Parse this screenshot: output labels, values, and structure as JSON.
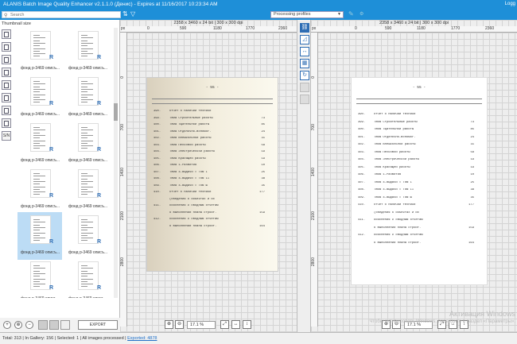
{
  "window": {
    "title": "ALANIS Batch Image Quality Enhancer v2.1.1.0 (Денис) - Expires at 11/16/2017 10:23:34 AM",
    "right_label": "Logg"
  },
  "toolbar": {
    "search_placeholder": "Search",
    "processing_profiles": "Processing profiles"
  },
  "left_panel": {
    "thumbnail_size_label": "Thumbnail size",
    "side_tools": [
      {
        "icon": "page-icon"
      },
      {
        "icon": "page-icon"
      },
      {
        "icon": "page-icon"
      },
      {
        "icon": "page-icon"
      },
      {
        "icon": "folder-icon"
      },
      {
        "icon": "page-icon"
      },
      {
        "icon": "page-icon"
      },
      {
        "icon": "page-icon"
      },
      {
        "icon": "sn",
        "label": "S/N"
      }
    ],
    "thumbnails": [
      {
        "caption": "фонд р-3469 описъ...",
        "badge": "R",
        "selected": false
      },
      {
        "caption": "фонд р-3469 описъ...",
        "badge": "R",
        "selected": false
      },
      {
        "caption": "фонд р-3469 описъ...",
        "badge": "R",
        "selected": false
      },
      {
        "caption": "фонд р-3469 описъ...",
        "badge": "R",
        "selected": false
      },
      {
        "caption": "фонд р-3469 описъ...",
        "badge": "R",
        "selected": false
      },
      {
        "caption": "фонд р-3469 описъ...",
        "badge": "R",
        "selected": false
      },
      {
        "caption": "фонд р-3469 описъ...",
        "badge": "R",
        "selected": false
      },
      {
        "caption": "фонд р-3469 описъ...",
        "badge": "R",
        "selected": false
      },
      {
        "caption": "фонд р-3469 описъ...",
        "badge": "R",
        "selected": true
      },
      {
        "caption": "фонд р-3469 описъ...",
        "badge": "R",
        "selected": false
      },
      {
        "caption": "фонд р-3469 описъ...",
        "badge": "R",
        "selected": false
      },
      {
        "caption": "фонд р-3469 описъ...",
        "badge": "R",
        "selected": false
      }
    ],
    "export_label": "EXPORT"
  },
  "left_viewer": {
    "info": "2358 x 3460 x 24 bit | 300 x 300 dpi",
    "unit": "px",
    "ruler_h": [
      "0",
      "590",
      "1180",
      "1770",
      "2360"
    ],
    "ruler_v": [
      "0",
      "700",
      "1400",
      "2100",
      "2800"
    ],
    "zoom": "17.1 %"
  },
  "right_viewer": {
    "info": "2358 x 3460 x 24 bit | 300 x 300 dpi",
    "unit": "px",
    "ruler_h": [
      "0",
      "590",
      "1180",
      "1770",
      "2360"
    ],
    "ruler_v": [
      "0",
      "700",
      "1400",
      "2100",
      "2800"
    ],
    "zoom": "17.1 %"
  },
  "document": {
    "page_header": "- 55 -",
    "rows": [
      {
        "n": "390.",
        "text": "Отчет о наличии техники",
        "v": ""
      },
      {
        "n": "399.",
        "text": "Тема Строительные работы",
        "v": "73"
      },
      {
        "n": "400.",
        "text": "Тема Тщательной работы",
        "v": "85"
      },
      {
        "n": "401.",
        "text": "Тема Отделочно-вспомог.",
        "v": "24"
      },
      {
        "n": "402.",
        "text": "Тема Внешкольной работы",
        "v": "31"
      },
      {
        "n": "403.",
        "text": "Тема Песковой работы",
        "v": "58"
      },
      {
        "n": "404.",
        "text": "Тема Электрической работы",
        "v": "19"
      },
      {
        "n": "405.",
        "text": "Тема Красящей работы",
        "v": "19"
      },
      {
        "n": "406.",
        "text": "Тема 1-Развития",
        "v": "10"
      },
      {
        "n": "407.",
        "text": "Тема 4-Выдачи = Том I",
        "v": "25"
      },
      {
        "n": "408.",
        "text": "Тема 4-Выдачи = Том II",
        "v": "38"
      },
      {
        "n": "409.",
        "text": "Тема 4-Выдачи = Том Ш",
        "v": "35"
      },
      {
        "n": "410.",
        "text": "Отчет о наличии техники",
        "v": "177"
      },
      {
        "n": "",
        "text": "(сведения о объектах и их",
        "v": ""
      },
      {
        "n": "411.",
        "text": "Пояснения к сводным отчетам",
        "v": ""
      },
      {
        "n": "",
        "text": "о выполнении плана строит.",
        "v": "159"
      },
      {
        "n": "412.",
        "text": "Пояснения к сводным отчетам",
        "v": ""
      },
      {
        "n": "",
        "text": "о выполнении плана строит.",
        "v": "164"
      }
    ]
  },
  "status_bar": {
    "total": "Total: 313",
    "in_gallery": "In Gallery: 156",
    "selected": "Selected: 1",
    "all_processed": "All images processed",
    "exported": "Exported: 4878"
  },
  "watermark": {
    "line1": "Активация Windows",
    "line2": "Чтобы активировать Windows, перейдите в раздел «Параметры»."
  },
  "colors": {
    "accent": "#1e8fd8",
    "badge": "#2e6db4",
    "selected": "#bcdcf5"
  }
}
